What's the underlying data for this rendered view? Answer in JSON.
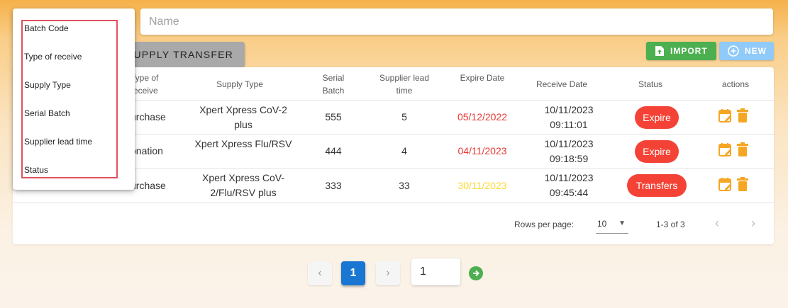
{
  "search": {
    "placeholder": "Name"
  },
  "toolbar": {
    "tab_label": "SUPPLY TRANSFER",
    "import_label": "IMPORT",
    "new_label": "NEW",
    "import_icon": "file-upload-icon",
    "new_icon": "plus-circle-icon",
    "import_color": "#4caf50",
    "new_color": "#90caf9"
  },
  "table": {
    "headers": {
      "type_of_receive": "Type of receive",
      "supply_type": "Supply Type",
      "serial_batch": "Serial Batch",
      "supplier_lead_time": "Supplier lead time",
      "expire_date": "Expire Date",
      "receive_date": "Receive Date",
      "status": "Status",
      "actions": "actions"
    },
    "rows": [
      {
        "type_of_receive": "urchase",
        "supply_type": "Xpert Xpress CoV-2 plus",
        "serial_batch": "555",
        "supplier_lead_time": "5",
        "expire_date": "05/12/2022",
        "expire_color": "#e53935",
        "receive_date": "10/11/2023 09:11:01",
        "status": "Expire"
      },
      {
        "type_of_receive": "onation",
        "supply_type": "Xpert Xpress Flu/RSV",
        "serial_batch": "444",
        "supplier_lead_time": "4",
        "expire_date": "04/11/2023",
        "expire_color": "#e53935",
        "receive_date": "10/11/2023 09:18:59",
        "status": "Expire"
      },
      {
        "type_of_receive": "urchase",
        "supply_type": "Xpert Xpress CoV-2/Flu/RSV plus",
        "serial_batch": "333",
        "supplier_lead_time": "33",
        "expire_date": "30/11/2023",
        "expire_color": "#fdd835",
        "receive_date": "10/11/2023 09:45:44",
        "status": "Transfers"
      }
    ],
    "action_icons": [
      "edit-calendar-icon",
      "delete-icon"
    ],
    "action_color": "#f5a623",
    "status_color": "#f44336"
  },
  "footer": {
    "rows_per_page_label": "Rows per page:",
    "rows_per_page_value": "10",
    "range_text": "1-3 of 3"
  },
  "column_menu": {
    "items": [
      "Batch Code",
      "Type of receive",
      "Supply Type",
      "Serial Batch",
      "Supplier lead time",
      "Status"
    ]
  },
  "pagination": {
    "current_page": "1",
    "page_input": "1"
  }
}
